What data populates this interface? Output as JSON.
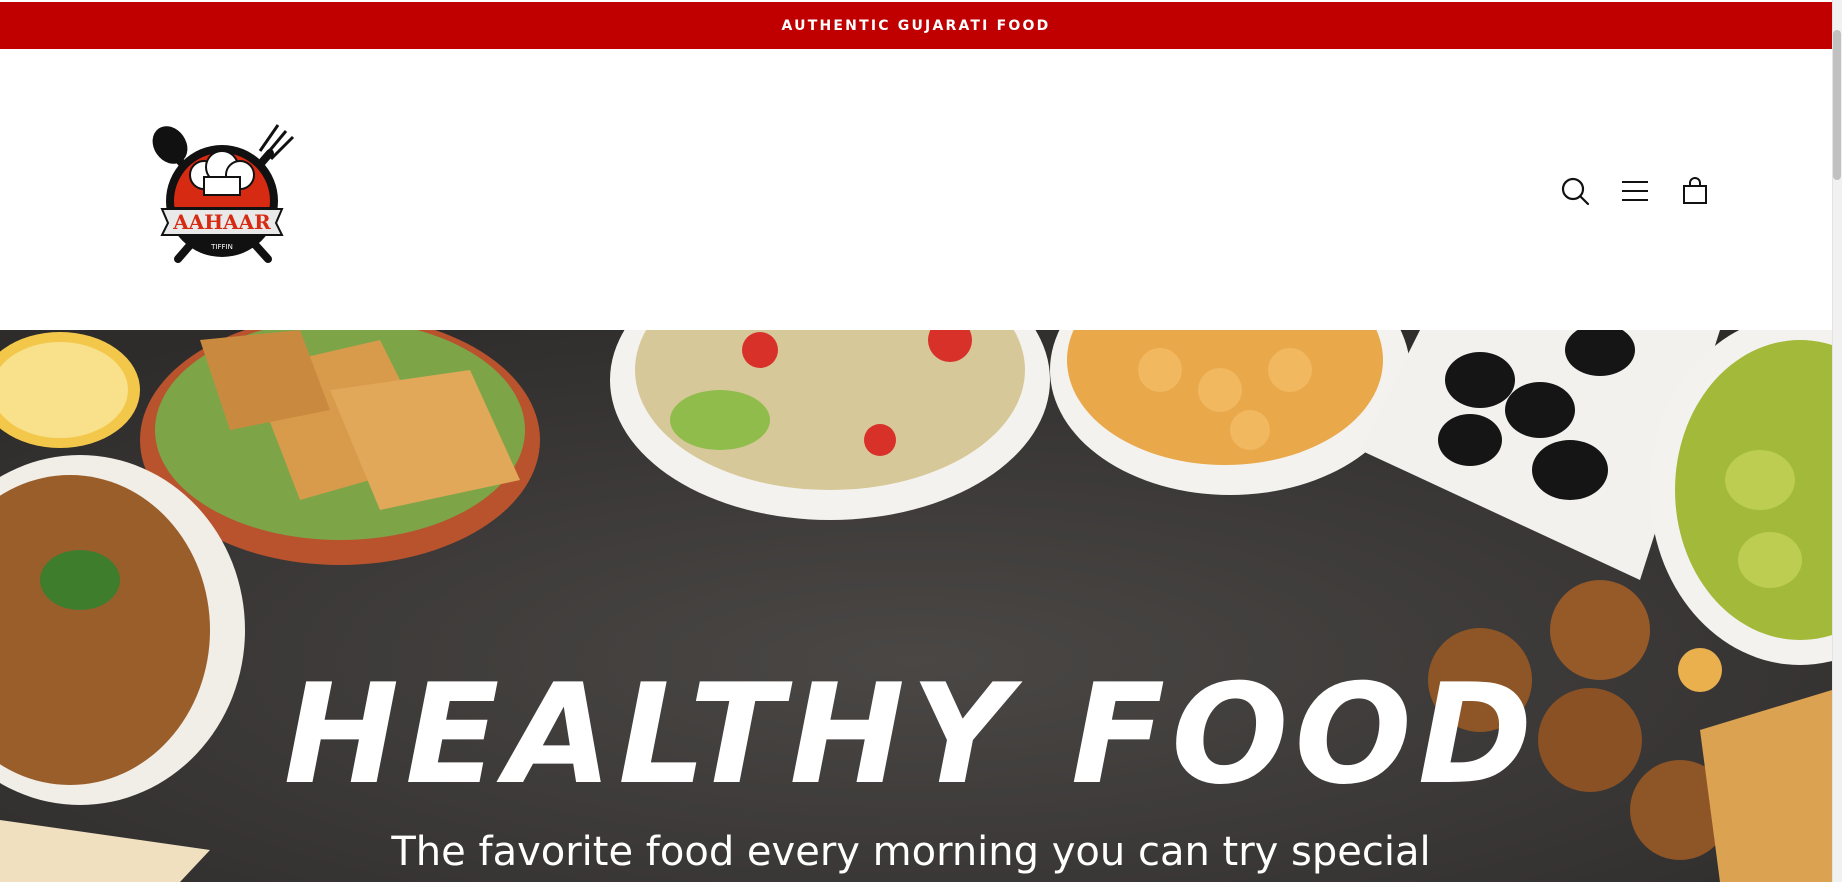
{
  "announcement": {
    "text": "AUTHENTIC GUJARATI FOOD"
  },
  "header": {
    "logo": {
      "brand": "AAHAAR",
      "tagline": "TIFFIN"
    },
    "icons": [
      "search-icon",
      "menu-icon",
      "cart-icon"
    ]
  },
  "hero": {
    "title": "HEALTHY FOOD",
    "subtitle": "The favorite food every morning you can try special"
  },
  "colors": {
    "announcement_bg": "#c00000",
    "hero_bg": "#3a3836",
    "text_light": "#ffffff"
  }
}
